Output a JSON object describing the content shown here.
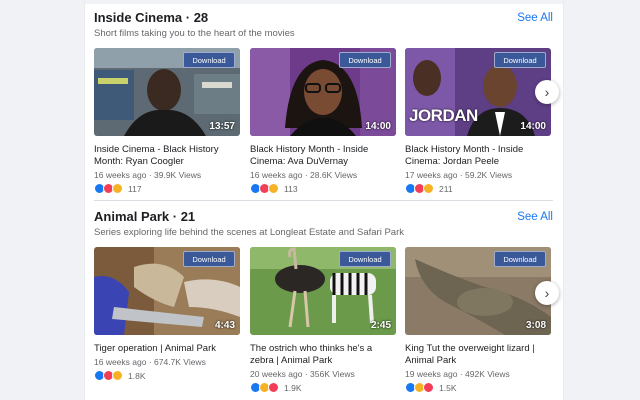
{
  "sections": [
    {
      "title": "Inside Cinema · 28",
      "see_all": "See All",
      "subtitle": "Short films taking you to the heart of the movies",
      "cards": [
        {
          "download": "Download",
          "duration": "13:57",
          "title": "Inside Cinema - Black History Month: Ryan Coogler",
          "meta": "16 weeks ago · 39.9K Views",
          "reactions": [
            "like",
            "love",
            "wow"
          ],
          "count": "117"
        },
        {
          "download": "Download",
          "duration": "14:00",
          "title": "Black History Month - Inside Cinema: Ava DuVernay",
          "meta": "16 weeks ago · 28.6K Views",
          "reactions": [
            "like",
            "love",
            "haha"
          ],
          "count": "113"
        },
        {
          "download": "Download",
          "duration": "14:00",
          "overlay_text": "JORDAN",
          "title": "Black History Month - Inside Cinema: Jordan Peele",
          "meta": "17 weeks ago · 59.2K Views",
          "reactions": [
            "like",
            "love",
            "wow"
          ],
          "count": "211"
        }
      ]
    },
    {
      "title": "Animal Park · 21",
      "see_all": "See All",
      "subtitle": "Series exploring life behind the scenes at Longleat Estate and Safari Park",
      "cards": [
        {
          "download": "Download",
          "duration": "4:43",
          "title": "Tiger operation | Animal Park",
          "meta": "16 weeks ago · 674.7K Views",
          "reactions": [
            "like",
            "love",
            "wow"
          ],
          "count": "1.8K"
        },
        {
          "download": "Download",
          "duration": "2:45",
          "title": "The ostrich who thinks he's a zebra | Animal Park",
          "meta": "20 weeks ago · 356K Views",
          "reactions": [
            "like",
            "haha",
            "love"
          ],
          "count": "1.9K"
        },
        {
          "download": "Download",
          "duration": "3:08",
          "title": "King Tut the overweight lizard | Animal Park",
          "meta": "19 weeks ago · 492K Views",
          "reactions": [
            "like",
            "haha",
            "love"
          ],
          "count": "1.5K"
        }
      ]
    }
  ],
  "icons": {
    "next": "chevron-right-icon"
  }
}
